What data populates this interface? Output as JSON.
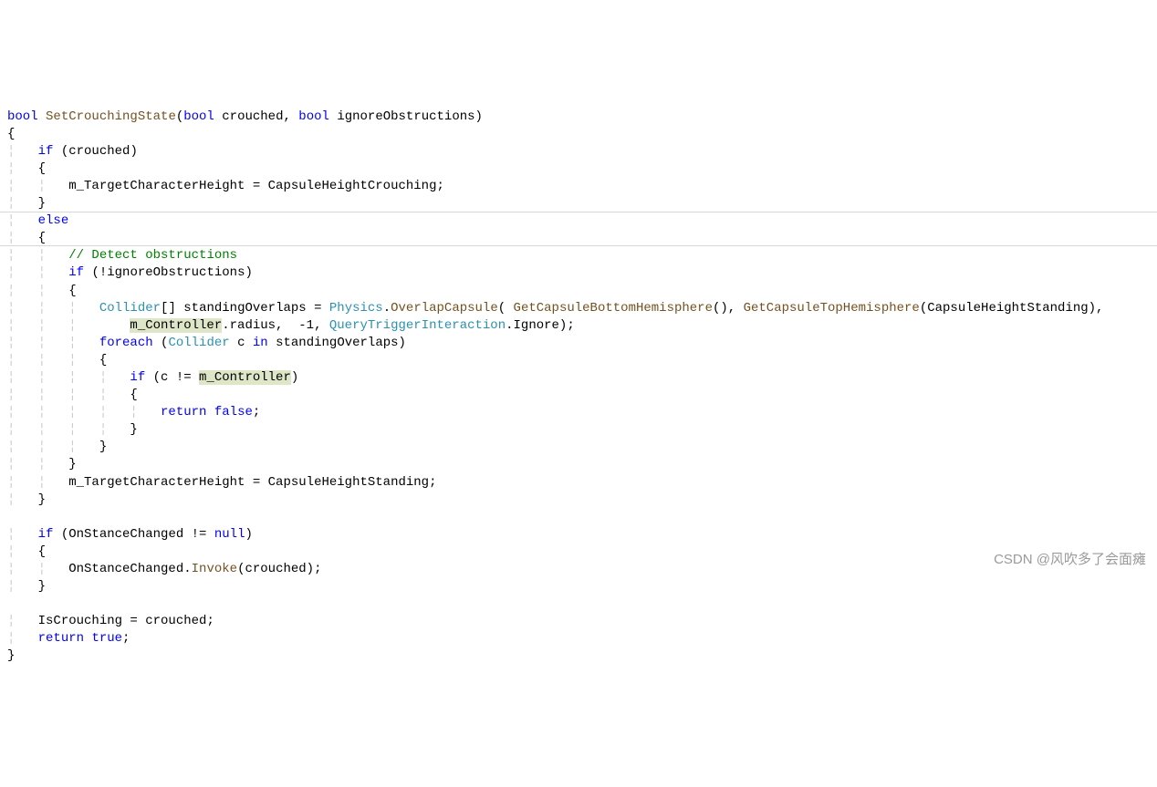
{
  "code": {
    "l1_kw_bool": "bool",
    "l1_method": "SetCrouchingState",
    "l1_kw_bool2": "bool",
    "l1_param1": "crouched",
    "l1_kw_bool3": "bool",
    "l1_param2": "ignoreObstructions",
    "l3_kw_if": "if",
    "l3_cond": "(crouched)",
    "l5_assign": "m_TargetCharacterHeight = CapsuleHeightCrouching;",
    "l7_kw_else": "else",
    "l9_comment": "// Detect obstructions",
    "l10_kw_if": "if",
    "l10_cond": "(!ignoreObstructions)",
    "l12_type": "Collider",
    "l12_brackets": "[]",
    "l12_var": " standingOverlaps = ",
    "l12_cls": "Physics",
    "l12_dot": ".",
    "l12_m1": "OverlapCapsule",
    "l12_open": "( ",
    "l12_m2": "GetCapsuleBottomHemisphere",
    "l12_paren1": "(), ",
    "l12_m3": "GetCapsuleTopHemisphere",
    "l12_paren2": "(CapsuleHeightStanding),",
    "l13_hl": "m_Controller",
    "l13_rest_a": ".radius,  -1, ",
    "l13_cls": "QueryTriggerInteraction",
    "l13_rest_b": ".Ignore);",
    "l14_kw_foreach": "foreach",
    "l14_open": " (",
    "l14_type": "Collider",
    "l14_rest": " c ",
    "l14_kw_in": "in",
    "l14_rest2": " standingOverlaps)",
    "l16_kw_if": "if",
    "l16_open": " (c != ",
    "l16_hl": "m_Controller",
    "l16_close": ")",
    "l18_kw_return": "return",
    "l18_kw_false": "false",
    "l22_assign": "m_TargetCharacterHeight = CapsuleHeightStanding;",
    "l25_kw_if": "if",
    "l25_cond": " (OnStanceChanged != ",
    "l25_kw_null": "null",
    "l25_close": ")",
    "l27_text_a": "OnStanceChanged.",
    "l27_method": "Invoke",
    "l27_text_b": "(crouched);",
    "l30_text": "IsCrouching = crouched;",
    "l31_kw_return": "return",
    "l31_kw_true": "true"
  },
  "watermark": "CSDN @风吹多了会面瘫"
}
